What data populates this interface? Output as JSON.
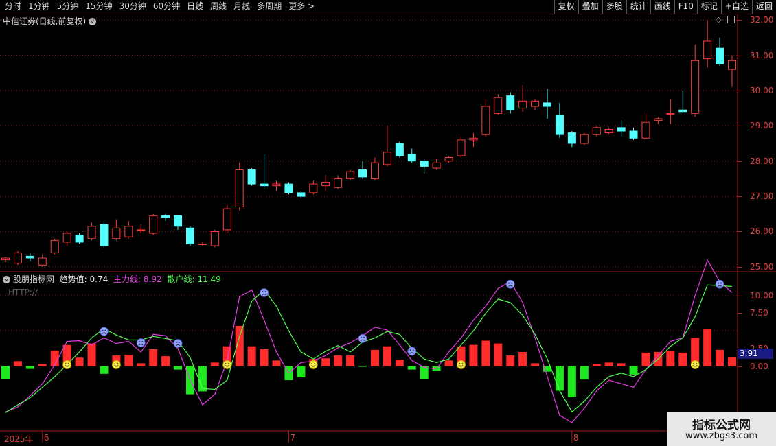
{
  "toolbar": {
    "periods": [
      "分时",
      "1分钟",
      "5分钟",
      "15分钟",
      "30分钟",
      "60分钟",
      "日线",
      "周线",
      "月线",
      "多周期",
      "更多 >"
    ],
    "active": "日线",
    "tools": [
      "复权",
      "叠加",
      "多股",
      "统计",
      "画线",
      "F10",
      "标记",
      "+自选",
      "返回"
    ]
  },
  "price_panel": {
    "title": "中信证券(日线,前复权)",
    "axis_labels": [
      "32.00",
      "31.00",
      "30.00",
      "29.00",
      "28.00",
      "27.00",
      "26.00",
      "25.00"
    ]
  },
  "indicator_panel": {
    "name": "股朋指标网",
    "trend_label": "趋势值:",
    "trend_value": "0.74",
    "main_label": "主力线:",
    "main_value": "8.92",
    "retail_label": "散户线:",
    "retail_value": "11.49",
    "watermark": "HTTP://",
    "axis_labels": [
      "10.00",
      "7.50",
      "2.50",
      "0.00"
    ],
    "current_value": "3.91"
  },
  "date_axis": {
    "year": "2025年",
    "months": [
      "6",
      "7",
      "8"
    ]
  },
  "brand": {
    "line1": "指标公式网",
    "line2": "www.zbgs3.com"
  },
  "colors": {
    "up": "#ff3c3c",
    "down": "#54ffff",
    "main_line": "#e83ce8",
    "retail_line": "#50ff50",
    "hist_up": "#ff2a2a",
    "hist_down": "#1ee81e"
  },
  "chart_data": [
    {
      "type": "candlestick",
      "title": "中信证券(日线,前复权)",
      "ylim": [
        24.9,
        32.1
      ],
      "candles": [
        [
          25.2,
          25.25,
          25.28,
          25.12
        ],
        [
          25.1,
          25.4,
          25.45,
          25.05
        ],
        [
          25.3,
          25.25,
          25.4,
          25.15
        ],
        [
          25.05,
          25.25,
          25.35,
          25.0
        ],
        [
          25.4,
          25.75,
          25.8,
          25.35
        ],
        [
          25.7,
          25.95,
          26.0,
          25.6
        ],
        [
          25.9,
          25.7,
          25.95,
          25.65
        ],
        [
          25.8,
          26.15,
          26.25,
          25.75
        ],
        [
          26.2,
          25.6,
          26.3,
          25.55
        ],
        [
          25.8,
          26.1,
          26.35,
          25.75
        ],
        [
          25.85,
          26.15,
          26.3,
          25.8
        ],
        [
          26.05,
          26.05,
          26.2,
          25.95
        ],
        [
          25.95,
          26.45,
          26.5,
          25.9
        ],
        [
          26.45,
          26.4,
          26.5,
          26.3
        ],
        [
          26.45,
          26.15,
          26.45,
          26.05
        ],
        [
          26.1,
          25.65,
          26.15,
          25.6
        ],
        [
          25.65,
          25.65,
          25.7,
          25.6
        ],
        [
          25.6,
          26.0,
          26.05,
          25.55
        ],
        [
          26.05,
          26.65,
          26.75,
          25.95
        ],
        [
          26.7,
          27.75,
          27.95,
          26.6
        ],
        [
          27.75,
          27.35,
          27.8,
          27.3
        ],
        [
          27.35,
          27.3,
          28.2,
          27.2
        ],
        [
          27.3,
          27.35,
          27.45,
          27.15
        ],
        [
          27.35,
          27.1,
          27.4,
          27.05
        ],
        [
          27.1,
          27.0,
          27.15,
          26.95
        ],
        [
          27.1,
          27.35,
          27.45,
          27.05
        ],
        [
          27.3,
          27.4,
          27.6,
          27.15
        ],
        [
          27.25,
          27.5,
          27.6,
          27.2
        ],
        [
          27.5,
          27.7,
          27.75,
          27.45
        ],
        [
          27.75,
          27.55,
          28.0,
          27.5
        ],
        [
          27.5,
          27.95,
          28.1,
          27.45
        ],
        [
          27.9,
          28.25,
          29.0,
          27.85
        ],
        [
          28.5,
          28.15,
          28.55,
          28.1
        ],
        [
          28.2,
          28.0,
          28.35,
          27.95
        ],
        [
          28.0,
          27.85,
          28.05,
          27.65
        ],
        [
          27.8,
          27.95,
          28.05,
          27.75
        ],
        [
          28.0,
          28.1,
          28.15,
          27.95
        ],
        [
          28.15,
          28.6,
          28.7,
          28.1
        ],
        [
          28.6,
          28.65,
          28.8,
          28.4
        ],
        [
          28.75,
          29.55,
          29.75,
          28.7
        ],
        [
          29.35,
          29.8,
          29.9,
          29.3
        ],
        [
          29.85,
          29.45,
          29.95,
          29.35
        ],
        [
          29.5,
          29.7,
          30.15,
          29.4
        ],
        [
          29.55,
          29.7,
          29.75,
          29.45
        ],
        [
          29.65,
          29.55,
          30.05,
          29.2
        ],
        [
          29.3,
          28.75,
          29.65,
          28.65
        ],
        [
          28.8,
          28.5,
          28.85,
          28.4
        ],
        [
          28.5,
          28.75,
          28.8,
          28.45
        ],
        [
          28.75,
          28.95,
          29.0,
          28.7
        ],
        [
          28.8,
          28.9,
          28.95,
          28.75
        ],
        [
          28.95,
          28.85,
          29.15,
          28.7
        ],
        [
          28.85,
          28.65,
          28.95,
          28.6
        ],
        [
          28.65,
          29.1,
          29.35,
          28.6
        ],
        [
          29.15,
          29.2,
          29.25,
          29.05
        ],
        [
          29.35,
          29.35,
          29.75,
          29.05
        ],
        [
          29.45,
          29.4,
          30.0,
          29.35
        ],
        [
          29.35,
          30.85,
          31.3,
          29.25
        ],
        [
          30.9,
          31.4,
          32.0,
          30.65
        ],
        [
          31.2,
          30.75,
          31.5,
          30.7
        ],
        [
          30.6,
          30.85,
          31.0,
          30.1
        ]
      ]
    },
    {
      "type": "bar+line",
      "ylim": [
        -9,
        12.6
      ],
      "histogram": [
        -1.8,
        0.7,
        -0.4,
        0.3,
        2.2,
        3.0,
        1.2,
        3.2,
        -1.1,
        1.5,
        1.6,
        0.4,
        2.4,
        1.4,
        -0.5,
        -4.0,
        -3.6,
        0.5,
        2.8,
        5.7,
        2.8,
        2.4,
        0.8,
        -2.0,
        -1.6,
        1.0,
        1.1,
        1.5,
        1.5,
        -0.1,
        2.3,
        2.8,
        0.9,
        -0.5,
        -1.8,
        -0.7,
        0.8,
        2.8,
        3.0,
        3.6,
        3.2,
        1.5,
        2.0,
        0.4,
        -0.8,
        -3.5,
        -4.4,
        -1.9,
        0.3,
        0.5,
        0.4,
        -1.2,
        1.9,
        2.0,
        2.1,
        1.9,
        4.0,
        5.2,
        2.3,
        1.3
      ],
      "main_line": [
        -6.5,
        -5.8,
        -4.2,
        -2.5,
        0.2,
        3.5,
        3.6,
        3.0,
        4.0,
        3.2,
        3.5,
        2.0,
        4.5,
        4.3,
        2.5,
        -2.0,
        -5.5,
        -4.0,
        0.8,
        9.8,
        10.8,
        6.5,
        2.0,
        -1.0,
        0.5,
        0.7,
        1.5,
        2.6,
        3.3,
        4.3,
        5.5,
        5.1,
        3.0,
        0.8,
        -0.2,
        -0.4,
        2.0,
        4.0,
        6.5,
        8.5,
        11.0,
        12.0,
        9.0,
        4.0,
        -1.5,
        -7.0,
        -8.0,
        -6.0,
        -3.5,
        -2.0,
        -2.5,
        -3.0,
        -0.5,
        1.5,
        3.5,
        4.0,
        10.0,
        15.0,
        12.0,
        10.4
      ],
      "retail_line": [
        -6.6,
        -5.5,
        -4.5,
        -3.0,
        -1.5,
        0.2,
        2.0,
        4.0,
        5.3,
        4.4,
        3.7,
        3.7,
        4.2,
        3.9,
        3.6,
        1.2,
        -3.2,
        -3.3,
        -2.0,
        4.2,
        9.2,
        10.8,
        8.5,
        5.0,
        2.0,
        1.0,
        2.1,
        2.9,
        2.0,
        3.4,
        4.0,
        4.9,
        4.5,
        2.5,
        1.0,
        0.5,
        1.0,
        3.0,
        5.0,
        7.5,
        9.5,
        9.0,
        7.2,
        4.5,
        1.0,
        -3.5,
        -6.5,
        -5.0,
        -3.0,
        -1.5,
        -1.0,
        -1.5,
        -0.5,
        1.0,
        2.8,
        4.0,
        7.0,
        11.5,
        11.4,
        11.3
      ],
      "happy_at": [
        5,
        9,
        18,
        25,
        37,
        56
      ],
      "sad_at": [
        8,
        11,
        14,
        21,
        29,
        33,
        41,
        58
      ]
    }
  ]
}
